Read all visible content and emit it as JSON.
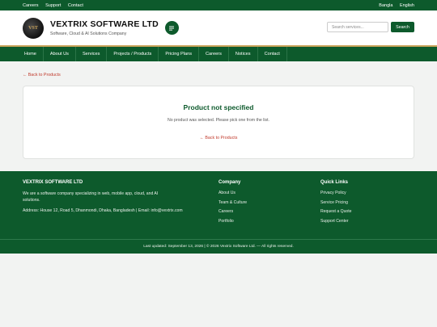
{
  "topbar": {
    "links": [
      "Careers",
      "Support",
      "Contact"
    ],
    "languages": [
      "Bangla",
      "English"
    ]
  },
  "header": {
    "logo_text": "VST",
    "brand_name": "VEXTRIX SOFTWARE LTD",
    "tagline": "Software, Cloud & AI Solutions Company",
    "menu_icon": "grid-menu-icon",
    "search_placeholder": "Search services...",
    "search_button": "Search"
  },
  "nav": {
    "items": [
      "Home",
      "About Us",
      "Services",
      "Projects / Products",
      "Pricing Plans",
      "Careers",
      "Notices",
      "Contact"
    ]
  },
  "main": {
    "back_link": "← Back to Products",
    "card": {
      "title": "Product not specified",
      "message": "No product was selected. Please pick one from the list.",
      "back_link": "← Back to Products"
    }
  },
  "footer": {
    "about": {
      "title": "VEXTRIX SOFTWARE LTD",
      "description": "We are a software company specializing in web, mobile app, cloud, and AI solutions.",
      "address": "Address: House 12, Road 5, Dhanmondi, Dhaka, Bangladesh | Email: info@vextrix.com"
    },
    "company": {
      "title": "Company",
      "links": [
        "About Us",
        "Team & Culture",
        "Careers",
        "Portfolio"
      ]
    },
    "quick_links": {
      "title": "Quick Links",
      "links": [
        "Privacy Policy",
        "Service Pricing",
        "Request a Quote",
        "Support Center"
      ]
    },
    "bottom_text": "Last updated: September 13, 2026 | © 2026 Vextrix Software Ltd. — All rights reserved."
  },
  "colors": {
    "brand_green": "#0d5a2c",
    "accent_gold": "#c9a35a",
    "link_red": "#c0392b"
  }
}
